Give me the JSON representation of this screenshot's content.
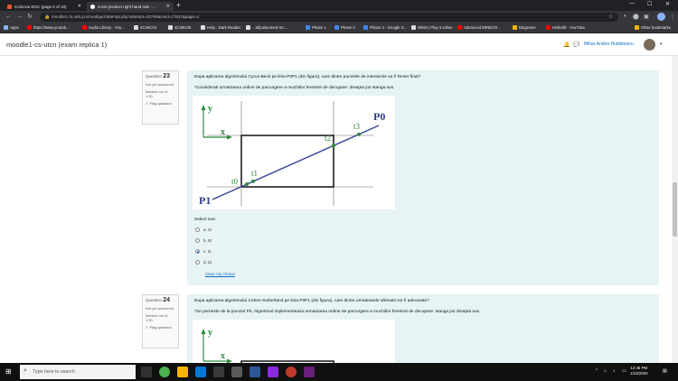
{
  "browser": {
    "tabs": [
      {
        "title": "Colocviu EGC (page 5 of 10)",
        "active": false,
        "color": "#e45735"
      },
      {
        "title": "cross product right hand rule - ...",
        "active": true,
        "color": "#ffffff"
      }
    ],
    "url": "moodle1.cs.utcluj.ro/mod/quiz/attempt.php?attempt=43790&cmid=17631&page=4",
    "bookmarks": [
      {
        "label": "Apps",
        "color": "#8ab4f8"
      },
      {
        "label": "https://www.youtub...",
        "color": "#ff0000"
      },
      {
        "label": "Audio Library - You...",
        "color": "#ff0000"
      },
      {
        "label": "4C28C04",
        "color": "#dddddd"
      },
      {
        "label": "4C28C05",
        "color": "#dddddd"
      },
      {
        "label": "Help - Dark Reader",
        "color": "#dddddd"
      },
      {
        "label": "...td/joeloomed-Inc...",
        "color": "#dddddd"
      },
      {
        "label": "Phase 1",
        "color": "#4285f4"
      },
      {
        "label": "Phase 2",
        "color": "#4285f4"
      },
      {
        "label": "Phase 3 - Google D...",
        "color": "#4285f4"
      },
      {
        "label": "Whist | Play it online",
        "color": "#dddddd"
      },
      {
        "label": "Advanced MINECR...",
        "color": "#ff0000"
      },
      {
        "label": "Diagrame",
        "color": "#f4b400"
      },
      {
        "label": "Hellexfit - YouTube",
        "color": "#ff0000"
      },
      {
        "label": "Other bookmarks",
        "color": "#f4b400"
      }
    ]
  },
  "header": {
    "site_title": "moodle1-cs-utcn (exam replica 1)",
    "user_name": "Mihai-Andrei Hudisteanu"
  },
  "questions": [
    {
      "label": "Question",
      "number": "23",
      "status": "Not yet answered",
      "marked": "Marked out of 1.00",
      "flag": "Flag question",
      "text": "Dupa aplicarea algoritmului Cyrus-Beck pe linia P0P1 (din figura), care dintre punctele de intersectie va fi Tenter final?",
      "note": "*Considerati urmatoarea ordine de parcurgere a muchiilor ferestrei de decupare: dreapta jos stanga sus.",
      "figure": {
        "y": "y",
        "x": "x",
        "p0": "P0",
        "p1": "P1",
        "t0": "t0",
        "t1": "t1",
        "t2": "t2",
        "t3": "t3"
      },
      "select": "Select one:",
      "options": [
        {
          "label": "a. t2",
          "checked": false
        },
        {
          "label": "b. t0",
          "checked": false
        },
        {
          "label": "c. t1",
          "checked": true
        },
        {
          "label": "d. t3",
          "checked": false
        }
      ],
      "clear": "Clear my choice"
    },
    {
      "label": "Question",
      "number": "24",
      "status": "Not yet answered",
      "marked": "Marked out of 1.00",
      "flag": "Flag question",
      "text": "Dupa aplicarea algoritmului Cohen-Sutherland pe linia P0P1 (din figura), care dintre urmatoarele afirmatii vor fi adevarate?",
      "note": "*Se porneste de la punctul P0. Algoritmul implementeaza urmatoarea ordine de parcurgere a muchiilor ferestrei de decupare: stanga jos dreapta sus.",
      "figure": {
        "y": "y",
        "x": "x"
      }
    }
  ],
  "taskbar": {
    "search_placeholder": "Type here to search",
    "time": "12:45 PM",
    "date": "1/10/2020"
  },
  "colors": {
    "accent": "#0f6fc5",
    "question_bg": "#e7f3f5",
    "line": "#3b4a9e",
    "label": "#2a8a3a",
    "p_label": "#2e3a8c"
  }
}
